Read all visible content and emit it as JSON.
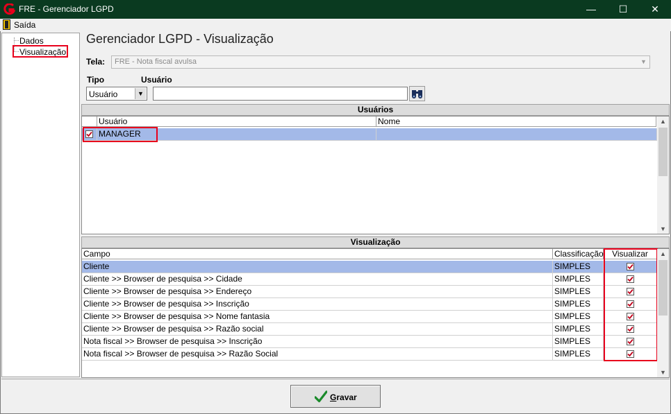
{
  "window": {
    "title": "FRE - Gerenciador LGPD",
    "minimize": "—",
    "maximize": "☐",
    "close": "✕"
  },
  "menu": {
    "exit_label": "Saída"
  },
  "sidebar": {
    "items": [
      {
        "label": "Dados"
      },
      {
        "label": "Visualização"
      }
    ]
  },
  "page": {
    "title": "Gerenciador LGPD - Visualização"
  },
  "form": {
    "tela_label": "Tela:",
    "tela_value": "FRE - Nota fiscal avulsa",
    "tipo_label": "Tipo",
    "tipo_value": "Usuário",
    "usuario_label": "Usuário",
    "usuario_value": ""
  },
  "users_panel": {
    "title": "Usuários",
    "columns": [
      "Usuário",
      "Nome"
    ],
    "rows": [
      {
        "checked": true,
        "usuario": "MANAGER",
        "nome": ""
      }
    ]
  },
  "view_panel": {
    "title": "Visualização",
    "columns": [
      "Campo",
      "Classificação",
      "Visualizar"
    ],
    "rows": [
      {
        "campo": "Cliente",
        "classificacao": "SIMPLES",
        "visualizar": true
      },
      {
        "campo": "Cliente >> Browser de pesquisa >> Cidade",
        "classificacao": "SIMPLES",
        "visualizar": true
      },
      {
        "campo": "Cliente >> Browser de pesquisa >> Endereço",
        "classificacao": "SIMPLES",
        "visualizar": true
      },
      {
        "campo": "Cliente >> Browser de pesquisa >> Inscrição",
        "classificacao": "SIMPLES",
        "visualizar": true
      },
      {
        "campo": "Cliente >> Browser de pesquisa >> Nome fantasia",
        "classificacao": "SIMPLES",
        "visualizar": true
      },
      {
        "campo": "Cliente >> Browser de pesquisa >> Razão social",
        "classificacao": "SIMPLES",
        "visualizar": true
      },
      {
        "campo": "Nota fiscal >> Browser de pesquisa >> Inscrição",
        "classificacao": "SIMPLES",
        "visualizar": true
      },
      {
        "campo": "Nota fiscal >> Browser de pesquisa >> Razão Social",
        "classificacao": "SIMPLES",
        "visualizar": true
      }
    ]
  },
  "footer": {
    "save_label_first": "G",
    "save_label_rest": "ravar"
  },
  "colors": {
    "titlebar": "#0a3a20",
    "highlight": "#e8001c",
    "selection": "#a3b9e8",
    "check": "#c0001a",
    "save_check": "#1a8a2a"
  }
}
